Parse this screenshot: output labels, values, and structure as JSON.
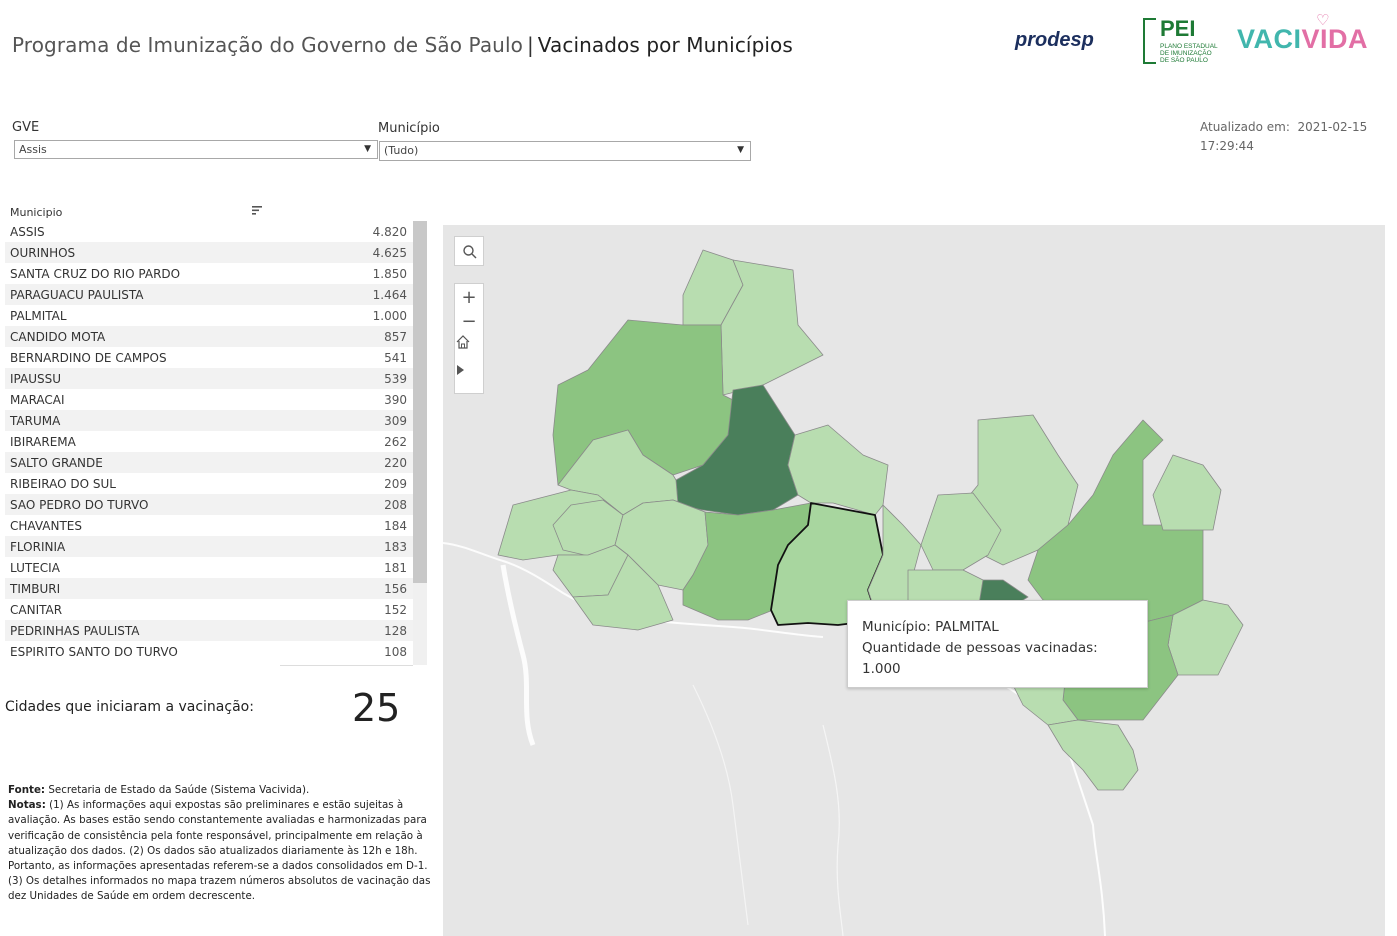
{
  "header": {
    "title_part1": "Programa de Imunização do Governo de São Paulo",
    "separator": "|",
    "title_part2": "Vacinados por Municípios",
    "logo_prodesp": "prodesp",
    "logo_pei_main": "PEI",
    "logo_pei_sub": "PLANO ESTADUAL DE IMUNIZAÇÃO DE SÃO PAULO",
    "logo_vacivida_a": "VACI",
    "logo_vacivida_b": "VIDA"
  },
  "filters": {
    "gve_label": "GVE",
    "gve_value": "Assis",
    "municipio_label": "Município",
    "municipio_value": "(Tudo)"
  },
  "updated": {
    "label": "Atualizado em:",
    "date": "2021-02-15",
    "time": "17:29:44"
  },
  "table": {
    "header": "Municipio",
    "rows": [
      {
        "name": "ASSIS",
        "value": "4.820"
      },
      {
        "name": "OURINHOS",
        "value": "4.625"
      },
      {
        "name": "SANTA CRUZ DO RIO PARDO",
        "value": "1.850"
      },
      {
        "name": "PARAGUACU PAULISTA",
        "value": "1.464"
      },
      {
        "name": "PALMITAL",
        "value": "1.000"
      },
      {
        "name": "CANDIDO MOTA",
        "value": "857"
      },
      {
        "name": "BERNARDINO DE CAMPOS",
        "value": "541"
      },
      {
        "name": "IPAUSSU",
        "value": "539"
      },
      {
        "name": "MARACAI",
        "value": "390"
      },
      {
        "name": "TARUMA",
        "value": "309"
      },
      {
        "name": "IBIRAREMA",
        "value": "262"
      },
      {
        "name": "SALTO GRANDE",
        "value": "220"
      },
      {
        "name": "RIBEIRAO DO SUL",
        "value": "209"
      },
      {
        "name": "SAO PEDRO DO TURVO",
        "value": "208"
      },
      {
        "name": "CHAVANTES",
        "value": "184"
      },
      {
        "name": "FLORINIA",
        "value": "183"
      },
      {
        "name": "LUTECIA",
        "value": "181"
      },
      {
        "name": "TIMBURI",
        "value": "156"
      },
      {
        "name": "CANITAR",
        "value": "152"
      },
      {
        "name": "PEDRINHAS PAULISTA",
        "value": "128"
      },
      {
        "name": "ESPIRITO SANTO DO TURVO",
        "value": "108"
      }
    ]
  },
  "summary": {
    "cities_label": "Cidades que iniciaram a vacinação:",
    "cities_count": "25"
  },
  "notes": {
    "fonte_label": "Fonte:",
    "fonte_text": " Secretaria de Estado da Saúde (Sistema Vacivida).",
    "notas_label": "Notas:",
    "notas_text": " (1) As informações aqui expostas são preliminares e estão sujeitas à avaliação. As bases estão sendo constantemente avaliadas e harmonizadas para verificação de consistência pela fonte responsável, principalmente em relação à atualização dos dados. (2) Os dados são atualizados diariamente às 12h e 18h. Portanto, as informações apresentadas referem-se a dados consolidados em D-1. (3) Os detalhes informados no mapa trazem números absolutos de vacinação das dez Unidades de Saúde em ordem decrescente."
  },
  "tooltip": {
    "line1": "Município: PALMITAL",
    "line2": "Quantidade de pessoas vacinadas: 1.000"
  },
  "map_tools": [
    "search-icon",
    "zoom-in-icon",
    "zoom-out-icon",
    "home-icon",
    "play-icon"
  ],
  "colors": {
    "dark_green": "#4a7f5b",
    "mid_green": "#8cc481",
    "light_green": "#b8ddb0",
    "map_bg": "#e6e6e6"
  }
}
